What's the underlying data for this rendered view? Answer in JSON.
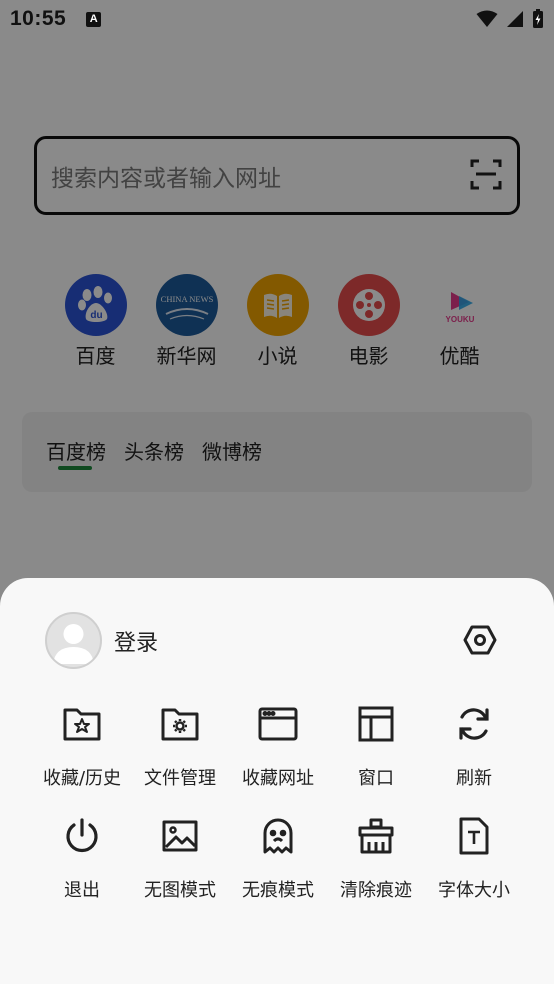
{
  "status_bar": {
    "time": "10:55",
    "notification_badge": "A"
  },
  "search": {
    "placeholder": "搜索内容或者输入网址"
  },
  "quick_sites": [
    {
      "label": "百度",
      "icon": "baidu-paw-icon",
      "color": "#2b54d6"
    },
    {
      "label": "新华网",
      "icon": "china-news-icon",
      "color": "#1d5b9c",
      "badge_text": "CHINA NEWS"
    },
    {
      "label": "小说",
      "icon": "book-icon",
      "color": "#f2a500"
    },
    {
      "label": "电影",
      "icon": "film-reel-icon",
      "color": "#e84c4c"
    },
    {
      "label": "优酷",
      "icon": "youku-play-icon",
      "color": "#ffffff",
      "badge_text": "YOUKU"
    }
  ],
  "hot_lists": {
    "tabs": [
      "百度榜",
      "头条榜",
      "微博榜"
    ],
    "active_index": 0,
    "accent": "#1e8a3c"
  },
  "menu": {
    "login_label": "登录",
    "items": [
      {
        "label": "收藏/历史",
        "icon": "star-folder-icon"
      },
      {
        "label": "文件管理",
        "icon": "gear-folder-icon"
      },
      {
        "label": "收藏网址",
        "icon": "browser-window-icon"
      },
      {
        "label": "窗口",
        "icon": "layout-window-icon"
      },
      {
        "label": "刷新",
        "icon": "refresh-icon"
      },
      {
        "label": "退出",
        "icon": "power-icon"
      },
      {
        "label": "无图模式",
        "icon": "image-icon"
      },
      {
        "label": "无痕模式",
        "icon": "ghost-icon"
      },
      {
        "label": "清除痕迹",
        "icon": "broom-icon"
      },
      {
        "label": "字体大小",
        "icon": "font-size-icon"
      }
    ]
  }
}
